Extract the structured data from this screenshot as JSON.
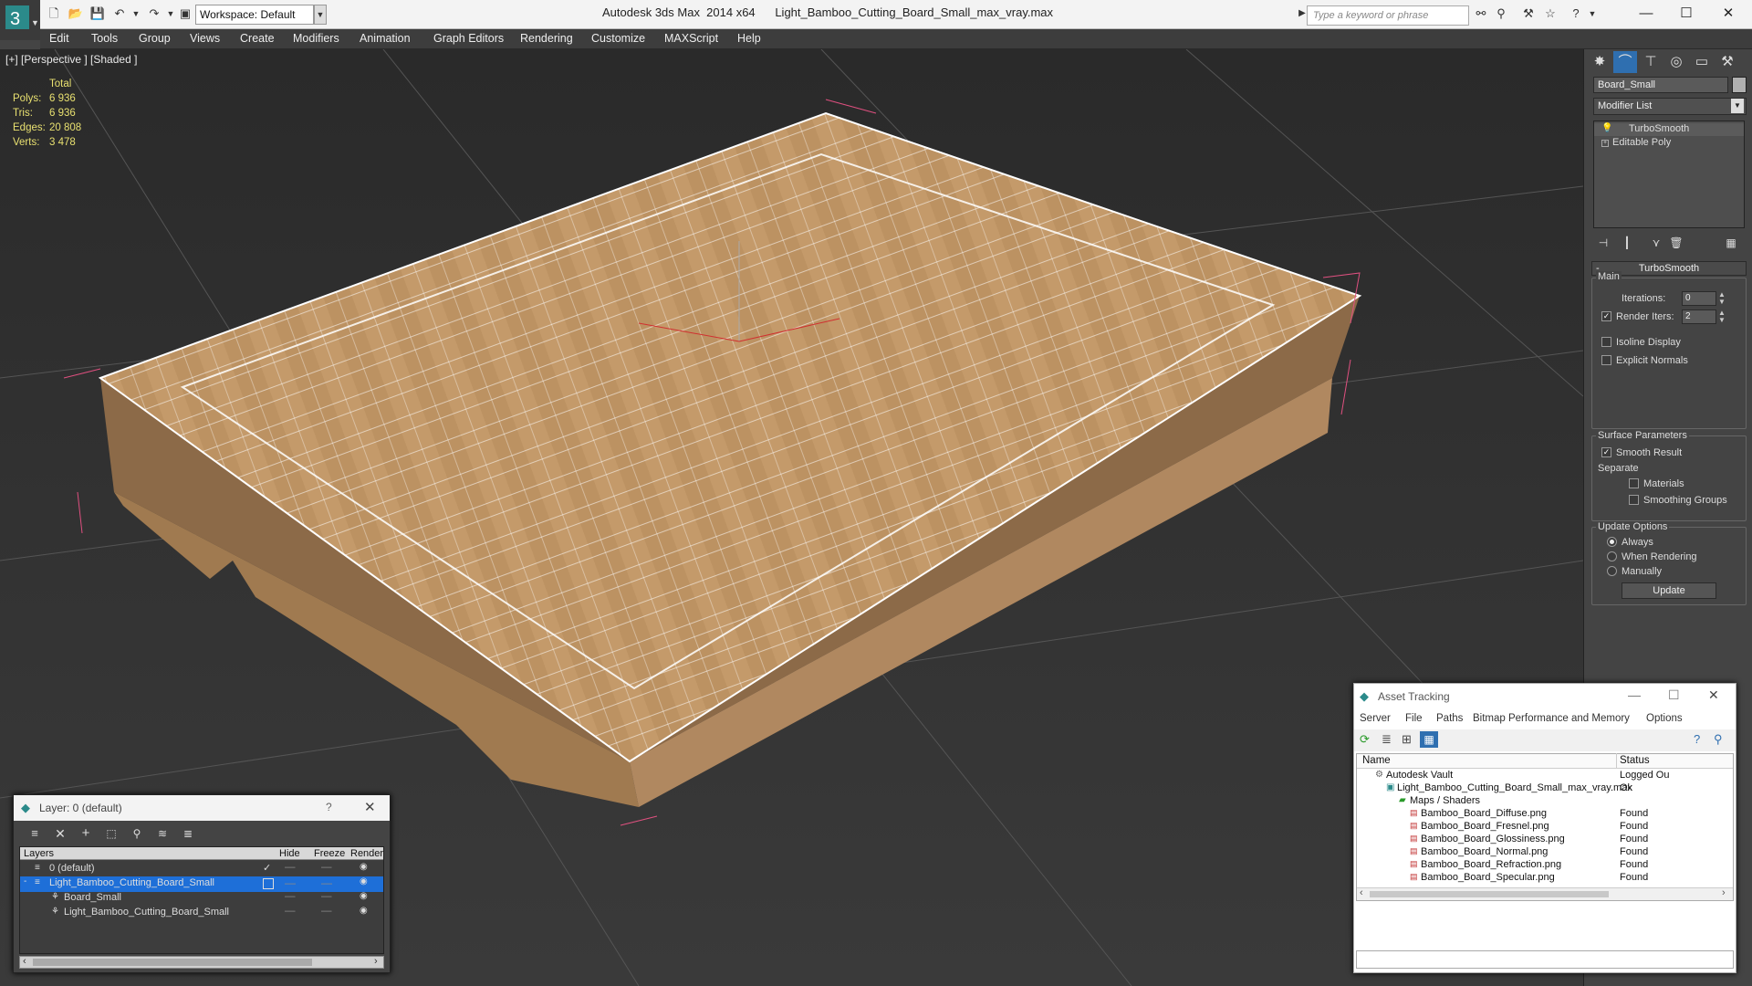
{
  "app": {
    "title": "Autodesk 3ds Max  2014 x64      Light_Bamboo_Cutting_Board_Small_max_vray.max",
    "workspace": "Workspace: Default",
    "search_placeholder": "Type a keyword or phrase"
  },
  "menu": [
    "Edit",
    "Tools",
    "Group",
    "Views",
    "Create",
    "Modifiers",
    "Animation",
    "Graph Editors",
    "Rendering",
    "Customize",
    "MAXScript",
    "Help"
  ],
  "viewport": {
    "label": "[+] [Perspective ] [Shaded ]",
    "stats": {
      "header": "Total",
      "rows": [
        {
          "k": "Polys:",
          "v": "6 936"
        },
        {
          "k": "Tris:",
          "v": "6 936"
        },
        {
          "k": "Edges:",
          "v": "20 808"
        },
        {
          "k": "Verts:",
          "v": "3 478"
        }
      ]
    }
  },
  "command_panel": {
    "object_name": "Board_Small",
    "modifier_list": "Modifier List",
    "stack": [
      "TurboSmooth",
      "Editable Poly"
    ],
    "rollout_title": "TurboSmooth",
    "main_label": "Main",
    "iterations_label": "Iterations:",
    "iterations_value": "0",
    "render_iters_label": "Render Iters:",
    "render_iters_value": "2",
    "isoline_label": "Isoline Display",
    "explicit_normals_label": "Explicit Normals",
    "surface_params_label": "Surface Parameters",
    "smooth_result_label": "Smooth Result",
    "separate_label": "Separate",
    "materials_label": "Materials",
    "smoothing_groups_label": "Smoothing Groups",
    "update_options_label": "Update Options",
    "always_label": "Always",
    "when_rendering_label": "When Rendering",
    "manually_label": "Manually",
    "update_button": "Update"
  },
  "layer_window": {
    "title": "Layer: 0 (default)",
    "help": "?",
    "columns": [
      "Layers",
      "Hide",
      "Freeze",
      "Render"
    ],
    "rows": [
      {
        "name": "0 (default)",
        "indent": 0,
        "selected": false
      },
      {
        "name": "Light_Bamboo_Cutting_Board_Small",
        "indent": 0,
        "selected": true
      },
      {
        "name": "Board_Small",
        "indent": 1,
        "selected": false
      },
      {
        "name": "Light_Bamboo_Cutting_Board_Small",
        "indent": 1,
        "selected": false
      }
    ]
  },
  "asset_window": {
    "title": "Asset Tracking",
    "menu": [
      "Server",
      "File",
      "Paths",
      "Bitmap Performance and Memory",
      "Options"
    ],
    "columns": [
      "Name",
      "Status"
    ],
    "rows": [
      {
        "name": "Autodesk Vault",
        "status": "Logged Ou",
        "indent": 1
      },
      {
        "name": "Light_Bamboo_Cutting_Board_Small_max_vray.max",
        "status": "Ok",
        "indent": 2
      },
      {
        "name": "Maps / Shaders",
        "status": "",
        "indent": 3
      },
      {
        "name": "Bamboo_Board_Diffuse.png",
        "status": "Found",
        "indent": 4
      },
      {
        "name": "Bamboo_Board_Fresnel.png",
        "status": "Found",
        "indent": 4
      },
      {
        "name": "Bamboo_Board_Glossiness.png",
        "status": "Found",
        "indent": 4
      },
      {
        "name": "Bamboo_Board_Normal.png",
        "status": "Found",
        "indent": 4
      },
      {
        "name": "Bamboo_Board_Refraction.png",
        "status": "Found",
        "indent": 4
      },
      {
        "name": "Bamboo_Board_Specular.png",
        "status": "Found",
        "indent": 4
      }
    ]
  },
  "colors": {
    "wood": "#c8a070",
    "selection": "#1e6fd8",
    "bbox": "#e05080",
    "stats": "#e8e070"
  }
}
